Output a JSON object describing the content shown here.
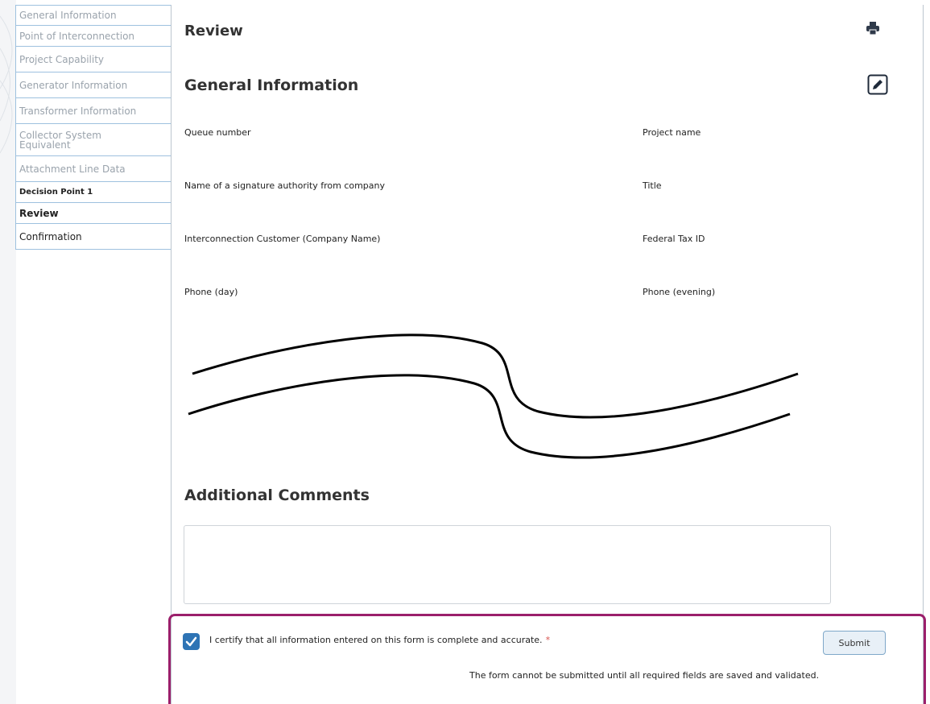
{
  "sidebar": {
    "items": [
      {
        "label": "General Information"
      },
      {
        "label": "Point of Interconnection"
      },
      {
        "label": "Project Capability"
      },
      {
        "label": "Generator Information"
      },
      {
        "label": "Transformer Information"
      },
      {
        "label": "Collector System Equivalent"
      },
      {
        "label": "Attachment Line Data"
      },
      {
        "label": "Decision Point 1"
      },
      {
        "label": "Review"
      },
      {
        "label": "Confirmation"
      }
    ]
  },
  "main": {
    "page_title": "Review",
    "print_icon": "printer-icon",
    "section_title": "General Information",
    "edit_icon": "pencil-icon",
    "fields": {
      "queue_number": "Queue number",
      "project_name": "Project name",
      "signature_authority": "Name of a signature authority from company",
      "title": "Title",
      "customer_company": "Interconnection Customer (Company Name)",
      "federal_tax_id": "Federal Tax ID",
      "phone_day": "Phone (day)",
      "phone_evening": "Phone (evening)"
    },
    "comments_title": "Additional Comments",
    "comments_value": ""
  },
  "certify": {
    "checked": true,
    "text": "I certify that all information entered on this form is complete and accurate.",
    "required_marker": "*",
    "submit_label": "Submit",
    "notice": "The form cannot be submitted until all required fields are saved and validated.",
    "highlight_color": "#9b1f6b",
    "checkbox_color": "#2e74b5"
  }
}
